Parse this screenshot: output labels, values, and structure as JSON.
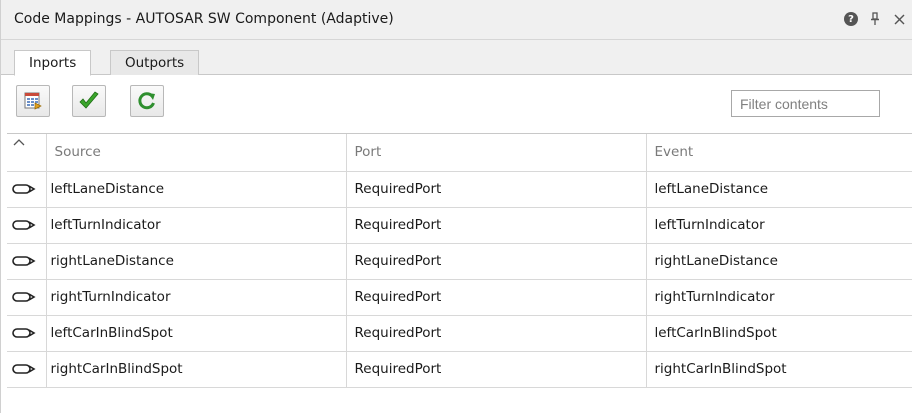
{
  "window": {
    "title": "Code Mappings - AUTOSAR SW Component (Adaptive)",
    "icons": [
      "help-icon",
      "pin-icon",
      "close-icon"
    ]
  },
  "tabs": [
    {
      "label": "Inports",
      "active": true
    },
    {
      "label": "Outports",
      "active": false
    }
  ],
  "toolbar": {
    "buttons": [
      "map-icon",
      "validate-icon",
      "refresh-icon"
    ],
    "filter": {
      "placeholder": "Filter contents",
      "value": ""
    }
  },
  "table": {
    "headers": [
      "Source",
      "Port",
      "Event"
    ],
    "sort_indicator": "ascending",
    "rows": [
      {
        "source": "leftLaneDistance",
        "port": "RequiredPort",
        "event": "leftLaneDistance"
      },
      {
        "source": "leftTurnIndicator",
        "port": "RequiredPort",
        "event": "leftTurnIndicator"
      },
      {
        "source": "rightLaneDistance",
        "port": "RequiredPort",
        "event": "rightLaneDistance"
      },
      {
        "source": "rightTurnIndicator",
        "port": "RequiredPort",
        "event": "rightTurnIndicator"
      },
      {
        "source": "leftCarInBlindSpot",
        "port": "RequiredPort",
        "event": "leftCarInBlindSpot"
      },
      {
        "source": "rightCarInBlindSpot",
        "port": "RequiredPort",
        "event": "rightCarInBlindSpot"
      }
    ]
  },
  "colors": {
    "titlebar_bg": "#f0f0f0",
    "header_text": "#7a7a7a",
    "check_green": "#3aa52b",
    "refresh_green": "#2f8f2f"
  }
}
